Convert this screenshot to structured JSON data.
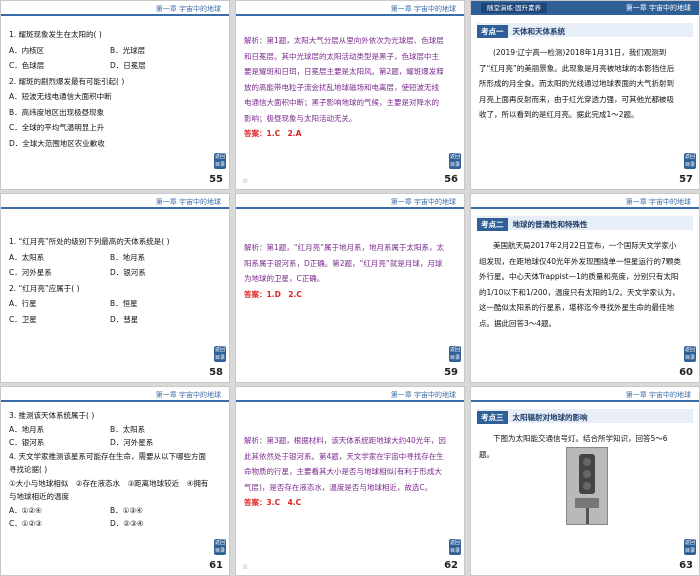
{
  "header_title": "第一章  宇宙中的地球",
  "banner": {
    "tag": "随堂演练·固升素养",
    "sub": "(5) 1对点练"
  },
  "slides": [
    {
      "num": "55",
      "lines": [
        "1. 耀斑现象发生在太阳的(    )"
      ],
      "opts1": [
        "A．内核区",
        "B．光球层",
        "C．色球层",
        "D．日冕层"
      ],
      "q2": "2. 耀斑的剧烈爆发最有可能引起(    )",
      "opts2": [
        "A．短波无线电通信大面积中断",
        "B．高纬度地区出现极昼现象",
        "C．全球的平均气温明显上升",
        "D．全球大范围地区农业歉收"
      ]
    },
    {
      "num": "56",
      "expl": "解析：第1题，太阳大气分层从里向外依次为光球层、色球层和日冕层。其中光球层的太阳活动类型是黑子，色球层中主要是耀斑和日珥，日冕层主要是太阳风。第2题，耀斑爆发释放的高能带电粒子流会扰乱地球磁场和电离层，使短波无线电通信大面积中断；黑子影响地球的气候，主要是对降水的影响；极昼现象与太阳活动无关。",
      "answer_label": "答案：",
      "answer": "1.C　2.A"
    },
    {
      "num": "57",
      "topic_k": "考点一",
      "topic": "天体和天体系统",
      "para": "(2019·辽宁高一检测)2018年1月31日，我们观测到了“红月亮”的美丽景象。此现象是月亮被地球的本影挡住后所形成的月全食。而太阳的光线通过地球表面的大气折射到月亮上面再反射而来，由于红光穿透力强，可其他光都被吸收了，所以看到的是红月亮。据此完成1～2题。"
    },
    {
      "num": "58",
      "q1": "1. “红月亮”所处的级别下列最高的天体系统是(    )",
      "opts1": [
        "A．太阳系",
        "B．地月系",
        "C．河外星系",
        "D．银河系"
      ],
      "q2": "2. “红月亮”应属于(    )",
      "opts2": [
        "A．行星",
        "B．恒星",
        "C．卫星",
        "D．彗星"
      ]
    },
    {
      "num": "59",
      "expl": "解析：第1题，“红月亮”属于地月系，地月系属于太阳系，太阳系属于银河系，D正确。第2题，“红月亮”就是月球，月球为地球的卫星，C正确。",
      "answer_label": "答案：",
      "answer": "1.D　2.C"
    },
    {
      "num": "60",
      "topic_k": "考点二",
      "topic": "地球的普通性和特殊性",
      "para": "美国航天局2017年2月22日宣布，一个国际天文学家小组发现，在距地球仅40光年外发现围绕单一恒星运行的7颗类外行星。中心天体Trappist—1的质量和亮度，分别只有太阳的1/10以下和1/200，温度只有太阳的1/2。天文学家认为，这一酷似太阳系的行星系，堪称迄今寻找外星生命的最佳地点。据此回答3～4题。"
    },
    {
      "num": "61",
      "q1": "3. 推测该天体系统属于(    )",
      "opts1": [
        "A．地月系",
        "B．太阳系",
        "C．银河系",
        "D．河外星系"
      ],
      "q2": "4. 天文学家推测该星系可能存在生命，需要从以下哪些方面寻找论据(    )",
      "cond": "①大小与地球相似　②存在液态水　③距离地球较近　④拥有与地球相近的温度",
      "opts2": [
        "A．①②④",
        "B．①③④",
        "C．①②③",
        "D．②③④"
      ]
    },
    {
      "num": "62",
      "expl": "解析：第3题，根据材料，该天体系统距地球大约40光年，因此其依然处于银河系。第4题，天文学家在宇宙中寻找存在生命物质的行星，主要看其大小是否与地球相似(有利于形成大气层)，是否存在液态水，温度是否与地球相近，故选C。",
      "answer_label": "答案：",
      "answer": "3.C　4.C"
    },
    {
      "num": "63",
      "topic_k": "考点三",
      "topic": "太阳辐射对地球的影响",
      "para": "下图为太阳能交通信号灯。结合所学知识，回答5～6题。"
    }
  ],
  "side_btn": "返回目录",
  "flag_text": "☆"
}
